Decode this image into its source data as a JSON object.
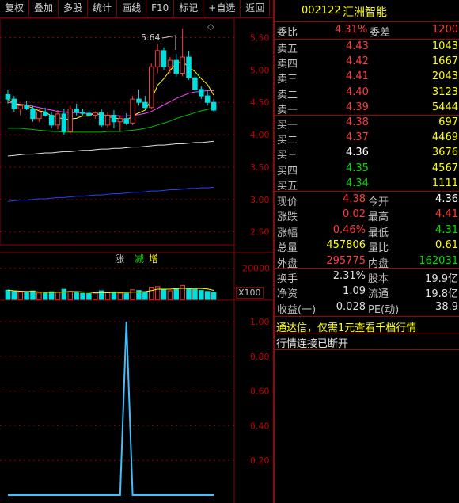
{
  "toolbar": {
    "items": [
      "复权",
      "叠加",
      "多股",
      "统计",
      "画线",
      "F10",
      "标记",
      "+自选",
      "返回"
    ]
  },
  "stock": {
    "code": "002122",
    "name": "汇洲智能"
  },
  "order_summary": {
    "ratio_label": "委比",
    "ratio_value": "4.31%",
    "diff_label": "委差",
    "diff_value": "1200"
  },
  "sell_levels": [
    {
      "label": "卖五",
      "price": "4.43",
      "volume": "1043"
    },
    {
      "label": "卖四",
      "price": "4.42",
      "volume": "1667"
    },
    {
      "label": "卖三",
      "price": "4.41",
      "volume": "2043"
    },
    {
      "label": "卖二",
      "price": "4.40",
      "volume": "3123"
    },
    {
      "label": "卖一",
      "price": "4.39",
      "volume": "5444"
    }
  ],
  "buy_levels": [
    {
      "label": "买一",
      "price": "4.38",
      "volume": "697"
    },
    {
      "label": "买二",
      "price": "4.37",
      "volume": "4469"
    },
    {
      "label": "买三",
      "price": "4.36",
      "volume": "3676"
    },
    {
      "label": "买四",
      "price": "4.35",
      "volume": "4567"
    },
    {
      "label": "买五",
      "price": "4.34",
      "volume": "1111"
    }
  ],
  "quote": {
    "rows": [
      {
        "l1": "现价",
        "v1": "4.38",
        "l2": "今开",
        "v2": "4.36"
      },
      {
        "l1": "涨跌",
        "v1": "0.02",
        "l2": "最高",
        "v2": "4.41"
      },
      {
        "l1": "涨幅",
        "v1": "0.46%",
        "l2": "最低",
        "v2": "4.31"
      },
      {
        "l1": "总量",
        "v1": "457806",
        "l2": "量比",
        "v2": "0.61"
      },
      {
        "l1": "外盘",
        "v1": "295775",
        "l2": "内盘",
        "v2": "162031"
      }
    ]
  },
  "finance": {
    "rows": [
      {
        "l1": "换手",
        "v1": "2.31%",
        "l2": "股本",
        "v2": "19.9亿"
      },
      {
        "l1": "净资",
        "v1": "1.09",
        "l2": "流通",
        "v2": "19.8亿"
      },
      {
        "l1": "收益(一)",
        "v1": "0.028",
        "l2": "PE(动)",
        "v2": "38.9"
      }
    ]
  },
  "notices": {
    "promo": "通达信，仅需1元查看千档行情",
    "status": "行情连接已断开"
  },
  "colors": {
    "up": "#ff3c3c",
    "down": "#00e0e0",
    "flat": "#ffffff",
    "green": "#00e000",
    "yellow": "#ffff00",
    "grid": "#8b0000"
  },
  "price_chart": {
    "y_ticks": [
      "5.50",
      "5.00",
      "4.50",
      "4.00",
      "3.50",
      "3.00",
      "2.50"
    ],
    "high_label": "5.64",
    "tags": [
      "涨",
      "减",
      "增"
    ]
  },
  "volume_chart": {
    "y_ticks": [
      "20000"
    ],
    "unit": "X100"
  },
  "indicator_chart": {
    "y_ticks": [
      "1.00",
      "0.80",
      "0.60",
      "0.40",
      "0.20"
    ]
  },
  "chart_data": [
    {
      "type": "candlestick",
      "ylim": [
        2.3,
        5.8
      ],
      "y_ticks": [
        5.5,
        5.0,
        4.5,
        4.0,
        3.5,
        3.0,
        2.5
      ],
      "annotations": [
        "5.64"
      ],
      "candles": [
        [
          4.62,
          4.7,
          4.48,
          4.55
        ],
        [
          4.55,
          4.6,
          4.35,
          4.4
        ],
        [
          4.4,
          4.48,
          4.3,
          4.45
        ],
        [
          4.45,
          4.52,
          4.38,
          4.4
        ],
        [
          4.4,
          4.45,
          4.2,
          4.25
        ],
        [
          4.25,
          4.4,
          4.2,
          4.35
        ],
        [
          4.35,
          4.42,
          4.28,
          4.3
        ],
        [
          4.3,
          4.35,
          4.1,
          4.15
        ],
        [
          4.15,
          4.38,
          4.08,
          4.32
        ],
        [
          4.32,
          4.4,
          4.0,
          4.05
        ],
        [
          4.05,
          4.45,
          4.02,
          4.4
        ],
        [
          4.4,
          4.48,
          4.3,
          4.35
        ],
        [
          4.35,
          4.4,
          4.3,
          4.33
        ],
        [
          4.33,
          4.38,
          4.28,
          4.3
        ],
        [
          4.3,
          4.36,
          4.25,
          4.34
        ],
        [
          4.34,
          4.4,
          4.12,
          4.15
        ],
        [
          4.15,
          4.35,
          4.1,
          4.3
        ],
        [
          4.3,
          4.38,
          4.1,
          4.2
        ],
        [
          4.2,
          4.3,
          4.05,
          4.25
        ],
        [
          4.25,
          4.33,
          4.15,
          4.18
        ],
        [
          4.18,
          4.6,
          4.15,
          4.55
        ],
        [
          4.55,
          4.7,
          4.45,
          4.5
        ],
        [
          4.5,
          4.6,
          4.4,
          4.42
        ],
        [
          4.42,
          5.1,
          4.4,
          5.05
        ],
        [
          5.05,
          5.4,
          4.95,
          5.3
        ],
        [
          5.3,
          5.35,
          5.0,
          5.05
        ],
        [
          5.05,
          5.2,
          4.95,
          5.15
        ],
        [
          5.15,
          5.25,
          4.9,
          4.95
        ],
        [
          4.95,
          5.64,
          4.9,
          5.2
        ],
        [
          5.2,
          5.3,
          4.85,
          4.88
        ],
        [
          4.88,
          4.95,
          4.65,
          4.7
        ],
        [
          4.7,
          4.75,
          4.55,
          4.6
        ],
        [
          4.6,
          4.68,
          4.45,
          4.5
        ],
        [
          4.5,
          4.55,
          4.36,
          4.38
        ]
      ],
      "series": [
        {
          "values": [
            4.5,
            4.49,
            4.47,
            4.46,
            4.44,
            4.42,
            4.4,
            4.38,
            4.36,
            4.35,
            4.34,
            4.34,
            4.33,
            4.33,
            4.32,
            4.31,
            4.3,
            4.3,
            4.29,
            4.29,
            4.3,
            4.31,
            4.33,
            4.36,
            4.41,
            4.46,
            4.51,
            4.56,
            4.6,
            4.64,
            4.66,
            4.67,
            4.68,
            4.68
          ]
        },
        {
          "values": [
            4.1,
            4.1,
            4.1,
            4.09,
            4.08,
            4.07,
            4.06,
            4.05,
            4.05,
            4.04,
            4.04,
            4.04,
            4.04,
            4.04,
            4.04,
            4.04,
            4.05,
            4.05,
            4.05,
            4.06,
            4.07,
            4.08,
            4.1,
            4.12,
            4.15,
            4.18,
            4.21,
            4.25,
            4.28,
            4.31,
            4.34,
            4.37,
            4.39,
            4.42
          ]
        },
        {
          "values": [
            3.67,
            3.68,
            3.69,
            3.7,
            3.7,
            3.71,
            3.72,
            3.72,
            3.73,
            3.74,
            3.74,
            3.75,
            3.76,
            3.76,
            3.77,
            3.78,
            3.78,
            3.79,
            3.79,
            3.8,
            3.81,
            3.81,
            3.82,
            3.83,
            3.84,
            3.84,
            3.85,
            3.86,
            3.86,
            3.87,
            3.88,
            3.88,
            3.89,
            3.9
          ]
        },
        {
          "values": [
            2.97,
            2.98,
            2.99,
            2.99,
            3.0,
            3.01,
            3.01,
            3.02,
            3.03,
            3.03,
            3.04,
            3.05,
            3.05,
            3.06,
            3.07,
            3.07,
            3.08,
            3.09,
            3.09,
            3.1,
            3.11,
            3.11,
            3.12,
            3.13,
            3.13,
            3.14,
            3.15,
            3.15,
            3.16,
            3.17,
            3.17,
            3.18,
            3.18,
            3.19
          ]
        }
      ]
    },
    {
      "type": "bar",
      "ylim": [
        0,
        28000
      ],
      "y_ticks": [
        20000
      ],
      "values": [
        6000,
        5200,
        4800,
        4500,
        5500,
        4200,
        4000,
        5000,
        4600,
        6500,
        5200,
        4300,
        4000,
        3800,
        4100,
        5600,
        4400,
        4900,
        4100,
        3900,
        6200,
        5800,
        5000,
        7800,
        8200,
        6400,
        5600,
        6900,
        9000,
        7200,
        6500,
        5800,
        5200,
        4600
      ]
    },
    {
      "type": "line",
      "ylim": [
        0,
        1.05
      ],
      "y_ticks": [
        1.0,
        0.8,
        0.6,
        0.4,
        0.2
      ],
      "values": [
        0,
        0,
        0,
        0,
        0,
        0,
        0,
        0,
        0,
        0,
        0,
        0,
        0,
        0,
        0,
        0,
        0,
        0,
        0,
        1,
        0,
        0,
        0,
        0,
        0,
        0,
        0,
        0,
        0,
        0,
        0,
        0,
        0,
        0
      ]
    }
  ]
}
